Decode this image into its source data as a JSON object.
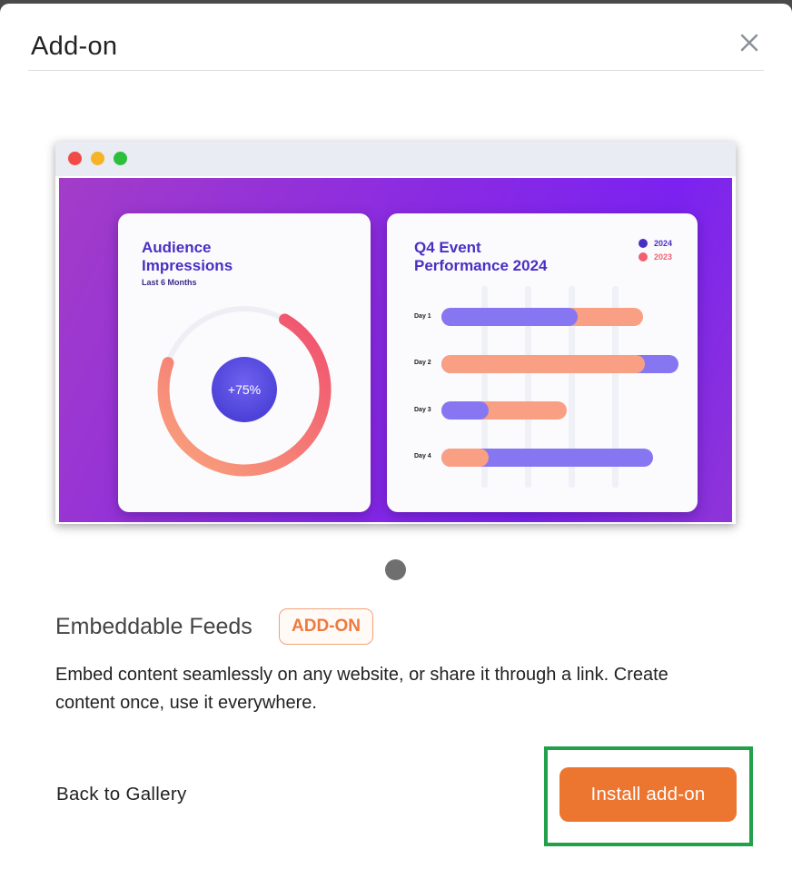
{
  "modal": {
    "title": "Add-on",
    "close_icon": "close-icon"
  },
  "preview": {
    "audience_card": {
      "title_line1": "Audience",
      "title_line2": "Impressions",
      "subtitle": "Last 6 Months",
      "gauge_label": "+75%",
      "gauge_progress": 0.75
    },
    "event_card": {
      "title_line1": "Q4 Event",
      "title_line2": "Performance 2024",
      "legend": [
        {
          "label": "2024",
          "color": "#4a2fc3"
        },
        {
          "label": "2023",
          "color": "#f06070"
        }
      ],
      "rows": [
        {
          "label": "Day 1"
        },
        {
          "label": "Day 2"
        },
        {
          "label": "Day 3"
        },
        {
          "label": "Day 4"
        }
      ]
    }
  },
  "addon": {
    "name": "Embeddable Feeds",
    "badge": "ADD-ON",
    "description": "Embed content seamlessly on any website, or share it through a link. Create content once, use it everywhere."
  },
  "footer": {
    "back_label": "Back to Gallery",
    "install_label": "Install add-on"
  },
  "colors": {
    "accent": "#ec7530",
    "badge_text": "#ee7a40",
    "highlight": "#23a04a"
  }
}
